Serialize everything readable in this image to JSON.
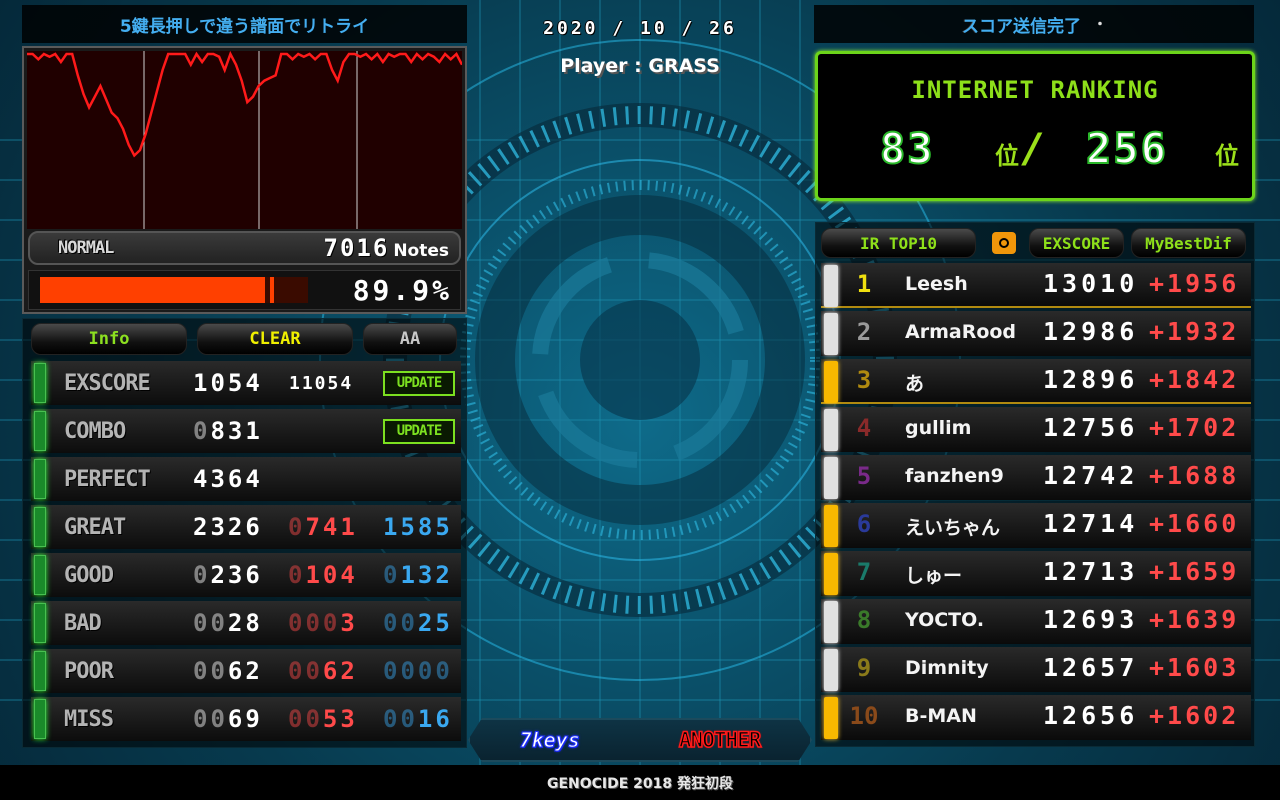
{
  "header": {
    "retry_hint": "5鍵長押しで違う譜面でリトライ",
    "date": "2020 / 10 / 26",
    "player_label": "Player : GRASS",
    "ir_status_ghost": "ス",
    "ir_status": "スコア送信完了",
    "ir_status_dot": "・"
  },
  "song": {
    "difficulty": "NORMAL",
    "notes_count": "7016",
    "notes_label": "Notes",
    "gauge_percent": 89.9,
    "gauge_display": "89.9%",
    "title": "GENOCIDE 2018 発狂初段",
    "keys": "7keys",
    "chart_difficulty": "ANOTHER"
  },
  "graph": {
    "series_color": "#ff1a1a",
    "description": "groove gauge over time",
    "gauge_values": [
      100,
      100,
      98,
      100,
      99,
      100,
      97,
      100,
      100,
      92,
      85,
      80,
      84,
      88,
      83,
      78,
      76,
      72,
      66,
      62,
      64,
      70,
      78,
      86,
      94,
      100,
      100,
      100,
      100,
      96,
      100,
      97,
      100,
      100,
      99,
      94,
      100,
      96,
      90,
      82,
      84,
      88,
      90,
      91,
      92,
      100,
      100,
      98,
      100,
      99,
      100,
      98,
      100,
      100,
      94,
      90,
      97,
      100,
      100,
      99,
      100,
      98,
      100,
      97,
      100,
      99,
      100,
      100,
      97,
      100,
      98,
      100,
      99,
      97,
      100,
      98,
      100,
      96
    ]
  },
  "stats": {
    "tabs": [
      "Info",
      "CLEAR",
      "AA"
    ],
    "rows": [
      {
        "label": "EXSCORE",
        "main": "1054",
        "main_lead": "",
        "sub": "11054",
        "update": "UPDATE"
      },
      {
        "label": "COMBO",
        "main": "831",
        "main_lead": "0",
        "update": "UPDATE"
      },
      {
        "label": "PERFECT",
        "main": "4364",
        "main_lead": ""
      },
      {
        "label": "GREAT",
        "main": "2326",
        "main_lead": "",
        "fast": "741",
        "fast_lead": "0",
        "slow": "1585",
        "slow_lead": ""
      },
      {
        "label": "GOOD",
        "main": "236",
        "main_lead": "0",
        "fast": "104",
        "fast_lead": "0",
        "slow": "132",
        "slow_lead": "0"
      },
      {
        "label": "BAD",
        "main": "28",
        "main_lead": "00",
        "fast": "3",
        "fast_lead": "000",
        "slow": "25",
        "slow_lead": "00"
      },
      {
        "label": "POOR",
        "main": "62",
        "main_lead": "00",
        "fast": "62",
        "fast_lead": "00",
        "slow": "",
        "slow_lead": "0000"
      },
      {
        "label": "MISS",
        "main": "69",
        "main_lead": "00",
        "fast": "53",
        "fast_lead": "00",
        "slow": "16",
        "slow_lead": "00"
      }
    ]
  },
  "internet_ranking": {
    "title": "INTERNET RANKING",
    "rank": "83",
    "rank_unit": "位",
    "slash": "/",
    "total": "256",
    "total_unit": "位"
  },
  "top10": {
    "tabs": {
      "ranking": "IR TOP10",
      "camera": "camera-icon",
      "sort": "EXSCORE",
      "diff": "MyBestDif"
    },
    "rows": [
      {
        "rank": "1",
        "rank_color": "#f0e010",
        "name": "Leesh",
        "score": "13010",
        "diff": "+1956",
        "led": "white",
        "highlight": true
      },
      {
        "rank": "2",
        "rank_color": "#9a9a9a",
        "name": "ArmaRood",
        "score": "12986",
        "diff": "+1932",
        "led": "white",
        "highlight": false
      },
      {
        "rank": "3",
        "rank_color": "#b08a10",
        "name": "あ",
        "score": "12896",
        "diff": "+1842",
        "led": "gold",
        "highlight": true
      },
      {
        "rank": "4",
        "rank_color": "#8a2a2a",
        "name": "gullim",
        "score": "12756",
        "diff": "+1702",
        "led": "white",
        "highlight": false
      },
      {
        "rank": "5",
        "rank_color": "#7a2a8a",
        "name": "fanzhen9",
        "score": "12742",
        "diff": "+1688",
        "led": "white",
        "highlight": false
      },
      {
        "rank": "6",
        "rank_color": "#2a3a9a",
        "name": "えいちゃん",
        "score": "12714",
        "diff": "+1660",
        "led": "gold",
        "highlight": false
      },
      {
        "rank": "7",
        "rank_color": "#1a7a6a",
        "name": "しゅー",
        "score": "12713",
        "diff": "+1659",
        "led": "gold",
        "highlight": false
      },
      {
        "rank": "8",
        "rank_color": "#3a7a2a",
        "name": "YOCTO.",
        "score": "12693",
        "diff": "+1639",
        "led": "white",
        "highlight": false
      },
      {
        "rank": "9",
        "rank_color": "#8a7a1a",
        "name": "Dimnity",
        "score": "12657",
        "diff": "+1603",
        "led": "white",
        "highlight": false
      },
      {
        "rank": "10",
        "rank_color": "#8a4a1a",
        "name": "B-MAN",
        "score": "12656",
        "diff": "+1602",
        "led": "gold",
        "highlight": false
      }
    ]
  },
  "colors": {
    "accent_green": "#8ee01a",
    "gauge_red": "#ff4000",
    "fast_red": "#ff4a4a",
    "slow_blue": "#3aa8f0",
    "banner_blue": "#44aef0"
  }
}
